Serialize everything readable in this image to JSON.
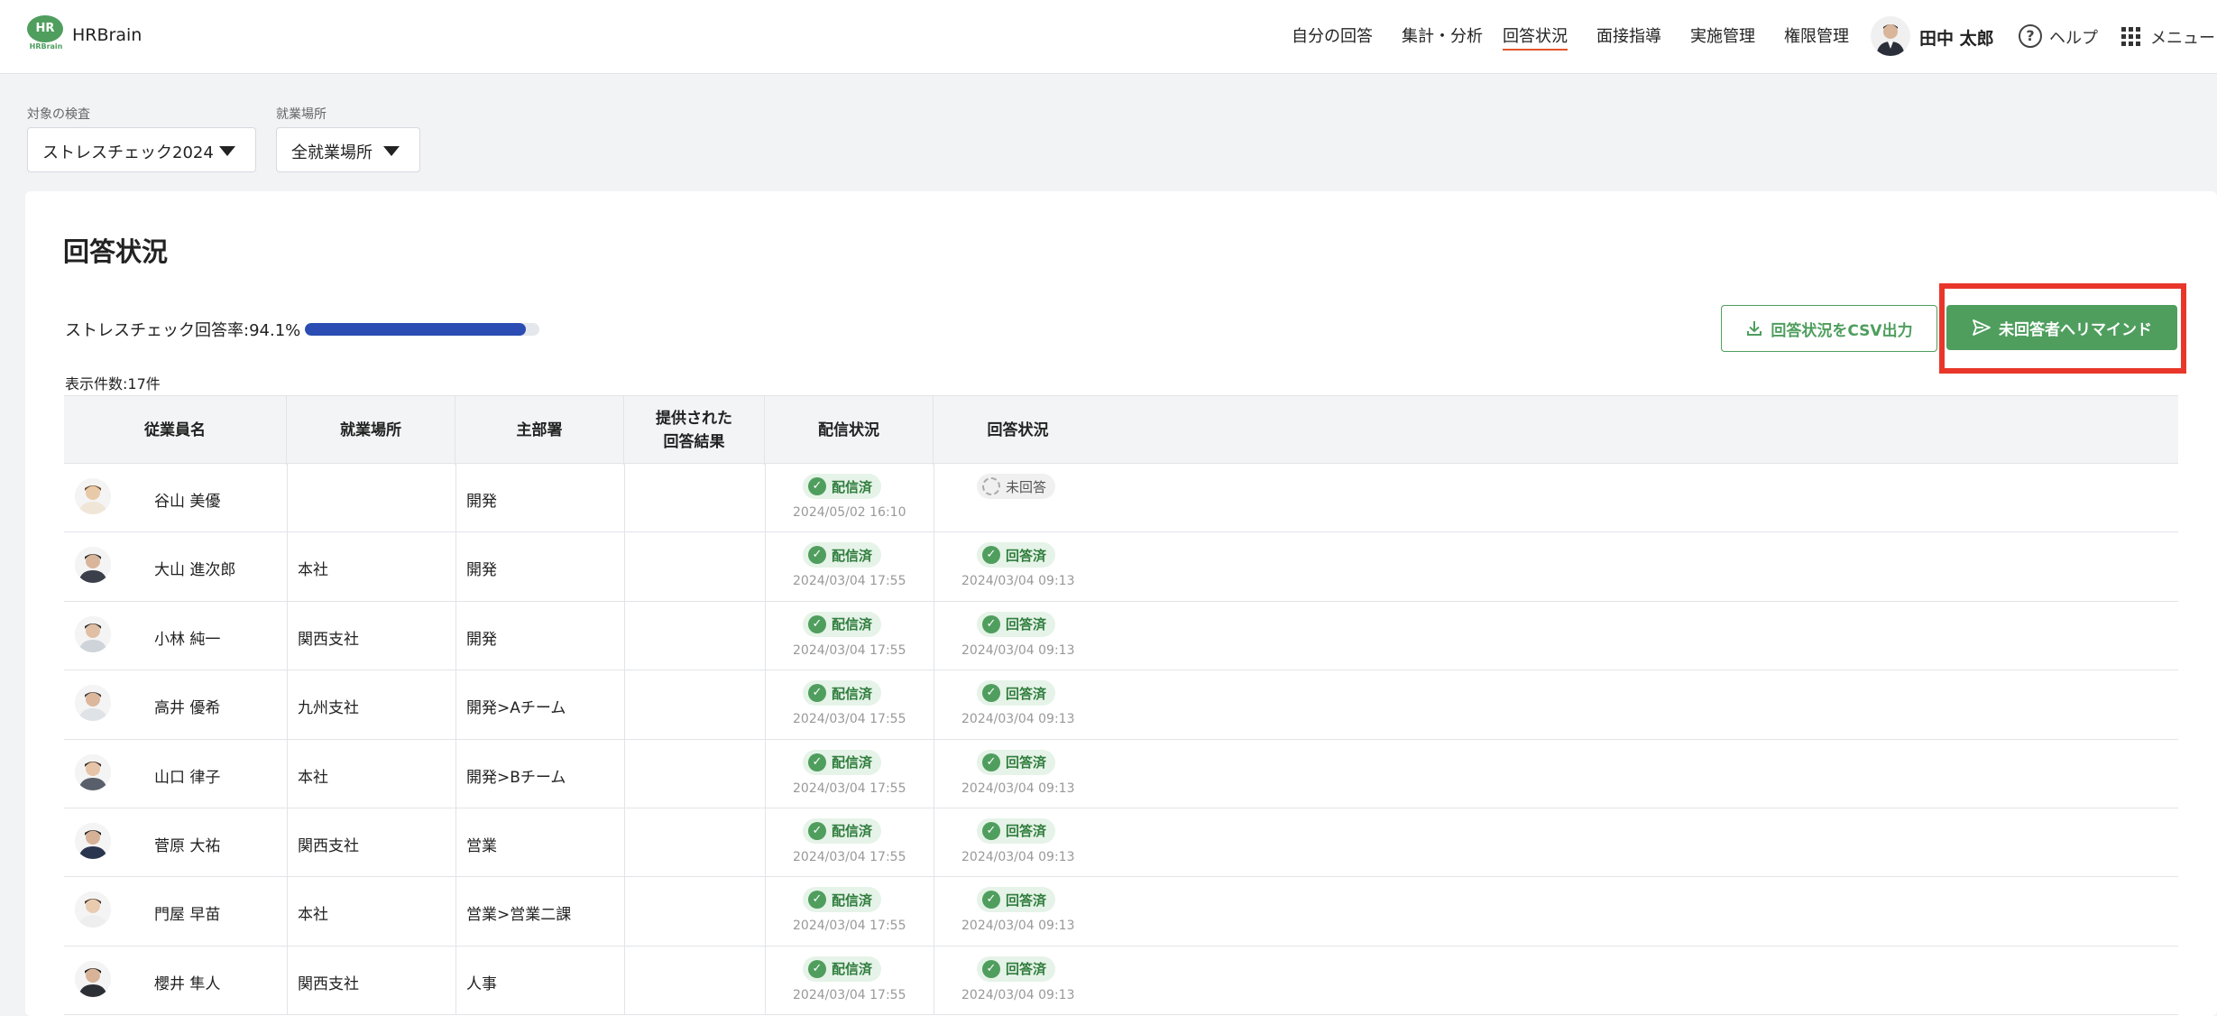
{
  "header": {
    "logo_text": "HR",
    "logo_sub": "HRBrain",
    "brand": "HRBrain",
    "nav": [
      {
        "label": "自分の回答",
        "active": false
      },
      {
        "label": "集計・分析",
        "active": false
      },
      {
        "label": "回答状況",
        "active": true
      },
      {
        "label": "面接指導",
        "active": false
      },
      {
        "label": "実施管理",
        "active": false
      },
      {
        "label": "権限管理",
        "active": false
      }
    ],
    "user_name": "田中 太郎",
    "help_label": "ヘルプ",
    "menu_label": "メニュー"
  },
  "filters": {
    "exam_label": "対象の検査",
    "exam_value": "ストレスチェック2024",
    "workplace_label": "就業場所",
    "workplace_value": "全就業場所"
  },
  "card": {
    "title": "回答状況",
    "rate_label": "ストレスチェック回答率:94.1%",
    "rate_value": 0.941,
    "count_label": "表示件数:17件",
    "csv_button": "回答状況をCSV出力",
    "remind_button": "未回答者へリマインド"
  },
  "table": {
    "headers": {
      "name": "従業員名",
      "workplace": "就業場所",
      "dept": "主部署",
      "provided": "提供された\n回答結果",
      "delivery": "配信状況",
      "answer": "回答状況"
    },
    "rows": [
      {
        "name": "谷山 美優",
        "workplace": "",
        "dept": "開発",
        "delivery": "配信済",
        "delivery_time": "2024/05/02 16:10",
        "answer": "未回答",
        "answer_time": "",
        "answered": false
      },
      {
        "name": "大山 進次郎",
        "workplace": "本社",
        "dept": "開発",
        "delivery": "配信済",
        "delivery_time": "2024/03/04 17:55",
        "answer": "回答済",
        "answer_time": "2024/03/04 09:13",
        "answered": true
      },
      {
        "name": "小林 純一",
        "workplace": "関西支社",
        "dept": "開発",
        "delivery": "配信済",
        "delivery_time": "2024/03/04 17:55",
        "answer": "回答済",
        "answer_time": "2024/03/04 09:13",
        "answered": true
      },
      {
        "name": "高井 優希",
        "workplace": "九州支社",
        "dept": "開発>Aチーム",
        "delivery": "配信済",
        "delivery_time": "2024/03/04 17:55",
        "answer": "回答済",
        "answer_time": "2024/03/04 09:13",
        "answered": true
      },
      {
        "name": "山口 律子",
        "workplace": "本社",
        "dept": "開発>Bチーム",
        "delivery": "配信済",
        "delivery_time": "2024/03/04 17:55",
        "answer": "回答済",
        "answer_time": "2024/03/04 09:13",
        "answered": true
      },
      {
        "name": "菅原 大祐",
        "workplace": "関西支社",
        "dept": "営業",
        "delivery": "配信済",
        "delivery_time": "2024/03/04 17:55",
        "answer": "回答済",
        "answer_time": "2024/03/04 09:13",
        "answered": true
      },
      {
        "name": "門屋 早苗",
        "workplace": "本社",
        "dept": "営業>営業二課",
        "delivery": "配信済",
        "delivery_time": "2024/03/04 17:55",
        "answer": "回答済",
        "answer_time": "2024/03/04 09:13",
        "answered": true
      },
      {
        "name": "櫻井 隼人",
        "workplace": "関西支社",
        "dept": "人事",
        "delivery": "配信済",
        "delivery_time": "2024/03/04 17:55",
        "answer": "回答済",
        "answer_time": "2024/03/04 09:13",
        "answered": true
      }
    ]
  },
  "colors": {
    "brand_green": "#4f9e5e",
    "progress_blue": "#2b4db3",
    "highlight_red": "#e8372a",
    "nav_active_underline": "#e4552a"
  }
}
